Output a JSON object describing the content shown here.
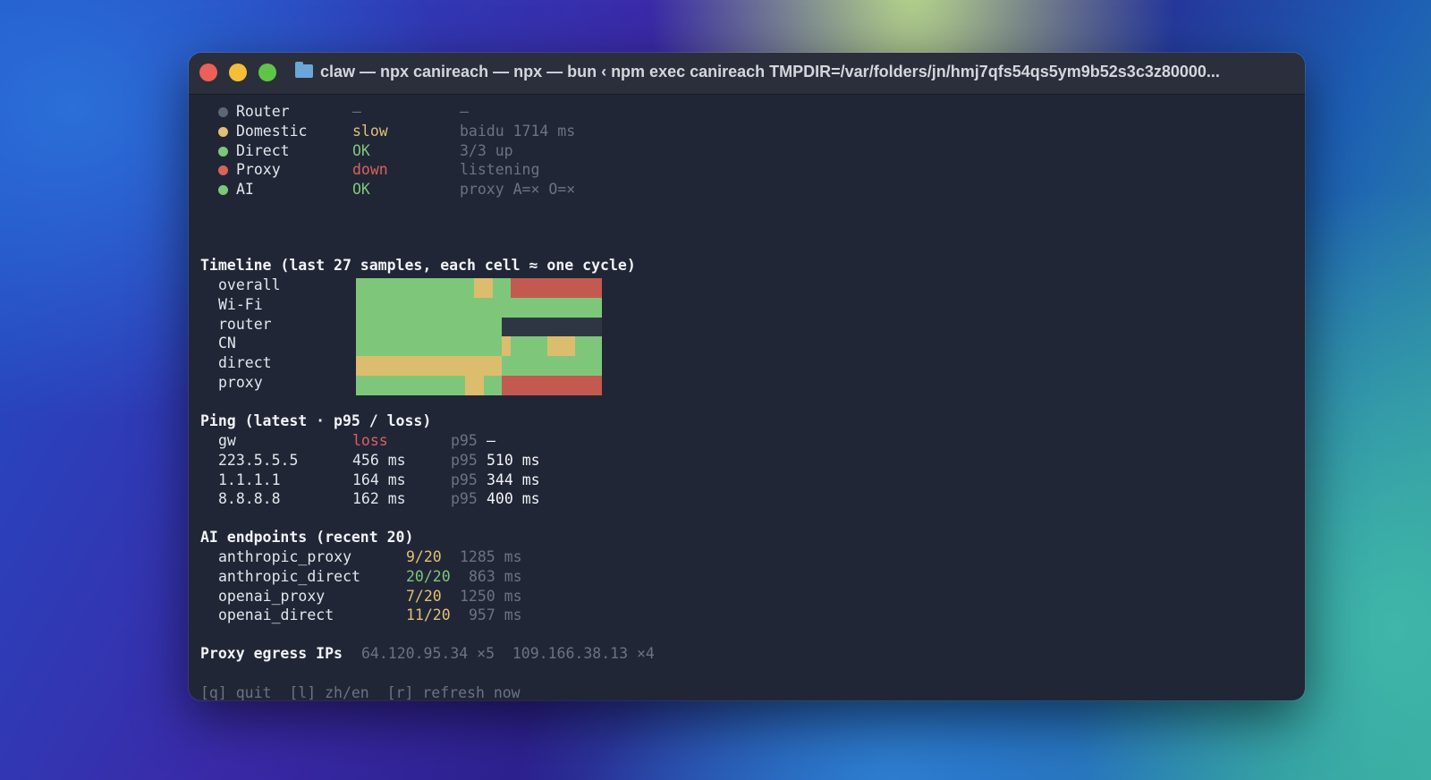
{
  "window": {
    "title": "claw — npx canireach — npx — bun ‹ npm exec canireach TMPDIR=/var/folders/jn/hmj7qfs54qs5ym9b52s3c3z80000..."
  },
  "status": [
    {
      "name": "Router",
      "state": "–",
      "detail": "–",
      "dot": "#5d6675"
    },
    {
      "name": "Domestic",
      "state": "slow",
      "detail": "baidu 1714 ms",
      "dot": "#e0c074"
    },
    {
      "name": "Direct",
      "state": "OK",
      "detail": "3/3 up",
      "dot": "#7ec77a"
    },
    {
      "name": "Proxy",
      "state": "down",
      "detail": "listening",
      "dot": "#d9625b"
    },
    {
      "name": "AI",
      "state": "OK",
      "detail": "proxy A=× O=×",
      "dot": "#7ec77a"
    }
  ],
  "timeline": {
    "heading": "Timeline (last 27 samples, each cell ≈ one cycle)",
    "rows": [
      {
        "label": "overall",
        "cells": "gggggggggggggyyggrrrrrrrrrrr"
      },
      {
        "label": "Wi-Fi",
        "cells": "ggggggggggggggggggggggggggg"
      },
      {
        "label": "router",
        "cells": "ggggggggggggggggkkkkkkkkkkk"
      },
      {
        "label": "CN",
        "cells": "ggggggggggggggggyggggyyyggggy"
      },
      {
        "label": "direct",
        "cells": "yyyyyyyyyyyyyyyyggggggggggg"
      },
      {
        "label": "proxy",
        "cells": "ggggggggggggyyggrrrrrrrrrrr"
      }
    ]
  },
  "ping": {
    "heading": "Ping (latest · p95 / loss)",
    "p95_label": "p95",
    "rows": [
      {
        "host": "gw",
        "latest": "loss",
        "p95": "—",
        "lossy": true
      },
      {
        "host": "223.5.5.5",
        "latest": "456 ms",
        "p95": "510 ms",
        "lossy": false
      },
      {
        "host": "1.1.1.1",
        "latest": "164 ms",
        "p95": "344 ms",
        "lossy": false
      },
      {
        "host": "8.8.8.8",
        "latest": "162 ms",
        "p95": "400 ms",
        "lossy": false
      }
    ]
  },
  "ai": {
    "heading": "AI endpoints (recent 20)",
    "rows": [
      {
        "name": "anthropic_proxy",
        "ratio": "9/20",
        "ms": "1285 ms",
        "color": "#e0c074"
      },
      {
        "name": "anthropic_direct",
        "ratio": "20/20",
        "ms": "863 ms",
        "color": "#7ec77a"
      },
      {
        "name": "openai_proxy",
        "ratio": "7/20",
        "ms": "1250 ms",
        "color": "#e0c074"
      },
      {
        "name": "openai_direct",
        "ratio": "11/20",
        "ms": "957 ms",
        "color": "#e0c074"
      }
    ]
  },
  "egress": {
    "label": "Proxy egress IPs",
    "ips": "64.120.95.34 ×5  109.166.38.13 ×4"
  },
  "footer": "[q] quit  [l] zh/en  [r] refresh now"
}
